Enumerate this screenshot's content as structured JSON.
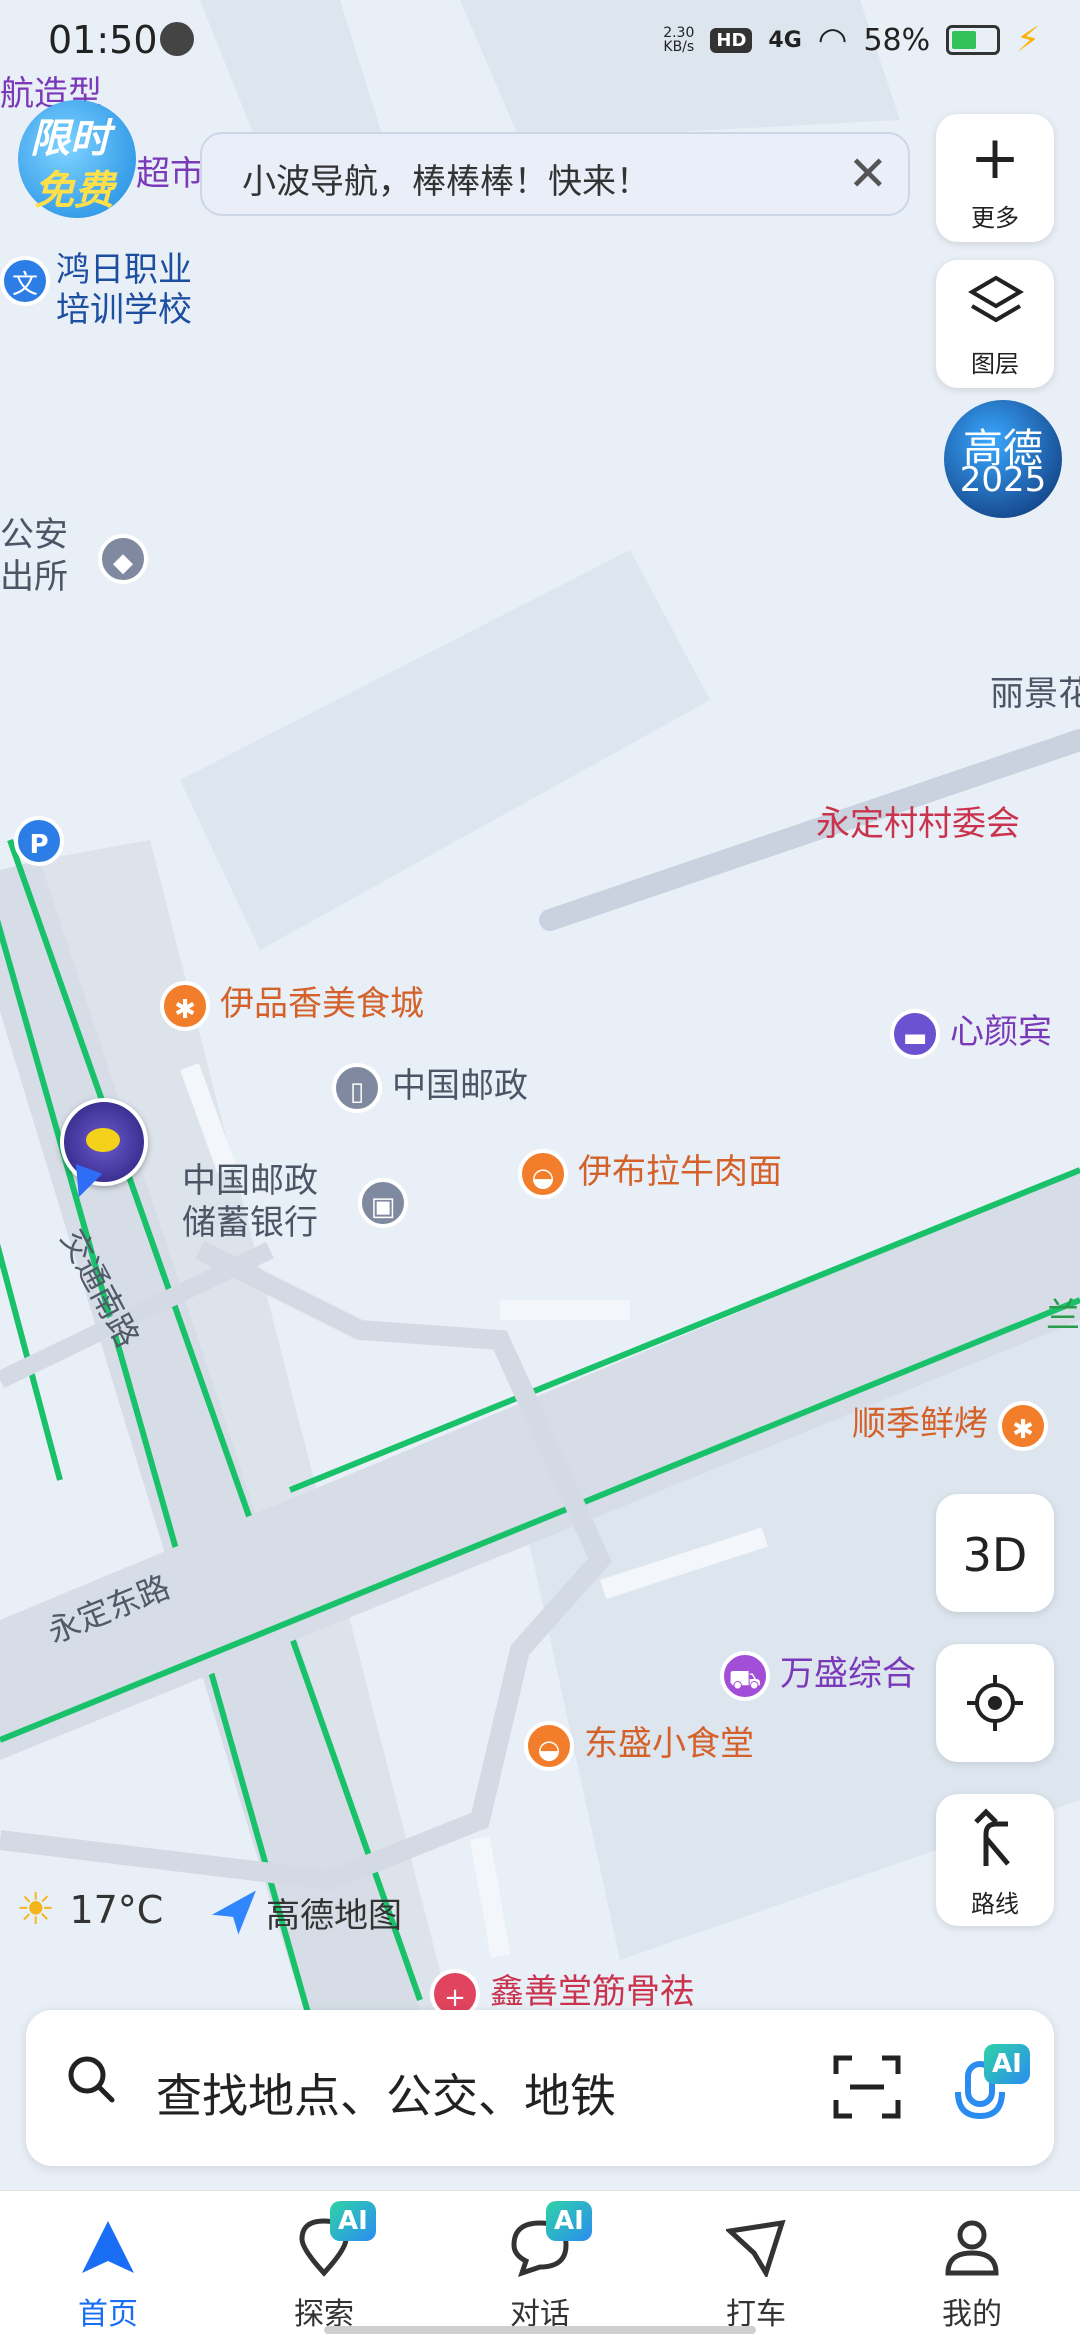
{
  "status_bar": {
    "time": "01:50",
    "net_speed": "2.30",
    "net_unit": "KB/s",
    "hd": "HD",
    "signal": "4G",
    "battery": "58%"
  },
  "banner": {
    "text": "小波导航，棒棒棒！快来！"
  },
  "promo": {
    "line1": "限时",
    "line2": "免费"
  },
  "side_buttons": {
    "more": "更多",
    "layers": "图层"
  },
  "gaode_badge": {
    "line1": "高德",
    "line2": "2025"
  },
  "map_labels": {
    "top_left_1": "航造型",
    "top_left_supermarket": "超市",
    "school_1": "鸿日职业",
    "school_2": "培训学校",
    "police_1": "公安",
    "police_2": "出所",
    "lijing": "丽景花",
    "village": "永定村村委会",
    "parking": "P",
    "yipin": "伊品香美食城",
    "post": "中国邮政",
    "bank_1": "中国邮政",
    "bank_2": "储蓄银行",
    "yibula": "伊布拉牛肉面",
    "xinyan": "心颜宾",
    "shunji": "顺季鲜烤",
    "wansheng": "万盛综合",
    "dongsheng": "东盛小食堂",
    "xinshan": "鑫善堂筋骨祛",
    "lan": "兰",
    "road_south": "交通南路",
    "road_east": "永定东路"
  },
  "view_controls": {
    "three_d": "3D",
    "route": "路线"
  },
  "weather": {
    "temp": "17°C"
  },
  "logo": {
    "name": "高德地图"
  },
  "search": {
    "placeholder": "查找地点、公交、地铁",
    "ai": "AI"
  },
  "tabs": [
    {
      "label": "首页"
    },
    {
      "label": "探索",
      "badge": "AI"
    },
    {
      "label": "对话",
      "badge": "AI"
    },
    {
      "label": "打车"
    },
    {
      "label": "我的"
    }
  ]
}
